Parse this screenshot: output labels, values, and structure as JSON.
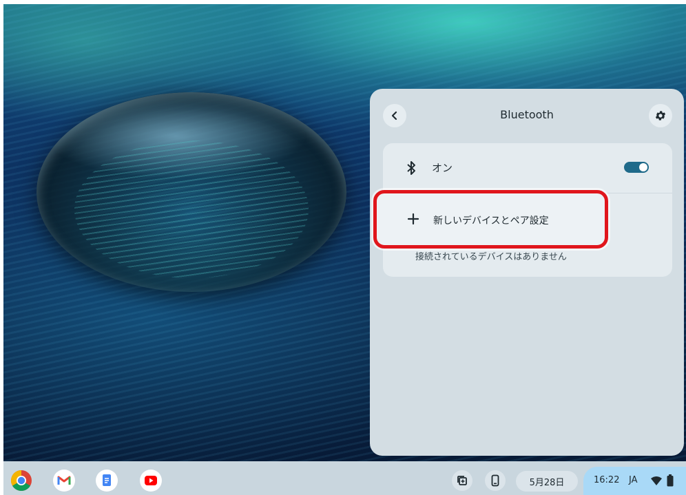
{
  "panel": {
    "title": "Bluetooth",
    "back_icon": "chevron-left-icon",
    "settings_icon": "gear-icon"
  },
  "bluetooth": {
    "toggle_label": "オン",
    "toggle_state": "on",
    "pair_label": "新しいデバイスとペア設定",
    "no_devices_text": "接続されているデバイスはありません"
  },
  "shelf": {
    "apps": [
      {
        "name": "Chrome",
        "icon": "chrome-icon"
      },
      {
        "name": "Gmail",
        "icon": "gmail-icon"
      },
      {
        "name": "Docs",
        "icon": "docs-icon"
      },
      {
        "name": "YouTube",
        "icon": "youtube-icon"
      }
    ],
    "date": "5月28日",
    "time": "16:22",
    "ime": "JA"
  },
  "colors": {
    "highlight": "#e0161c",
    "toggle_on": "#1f6a8a",
    "status_pill": "#a9d9f7"
  }
}
